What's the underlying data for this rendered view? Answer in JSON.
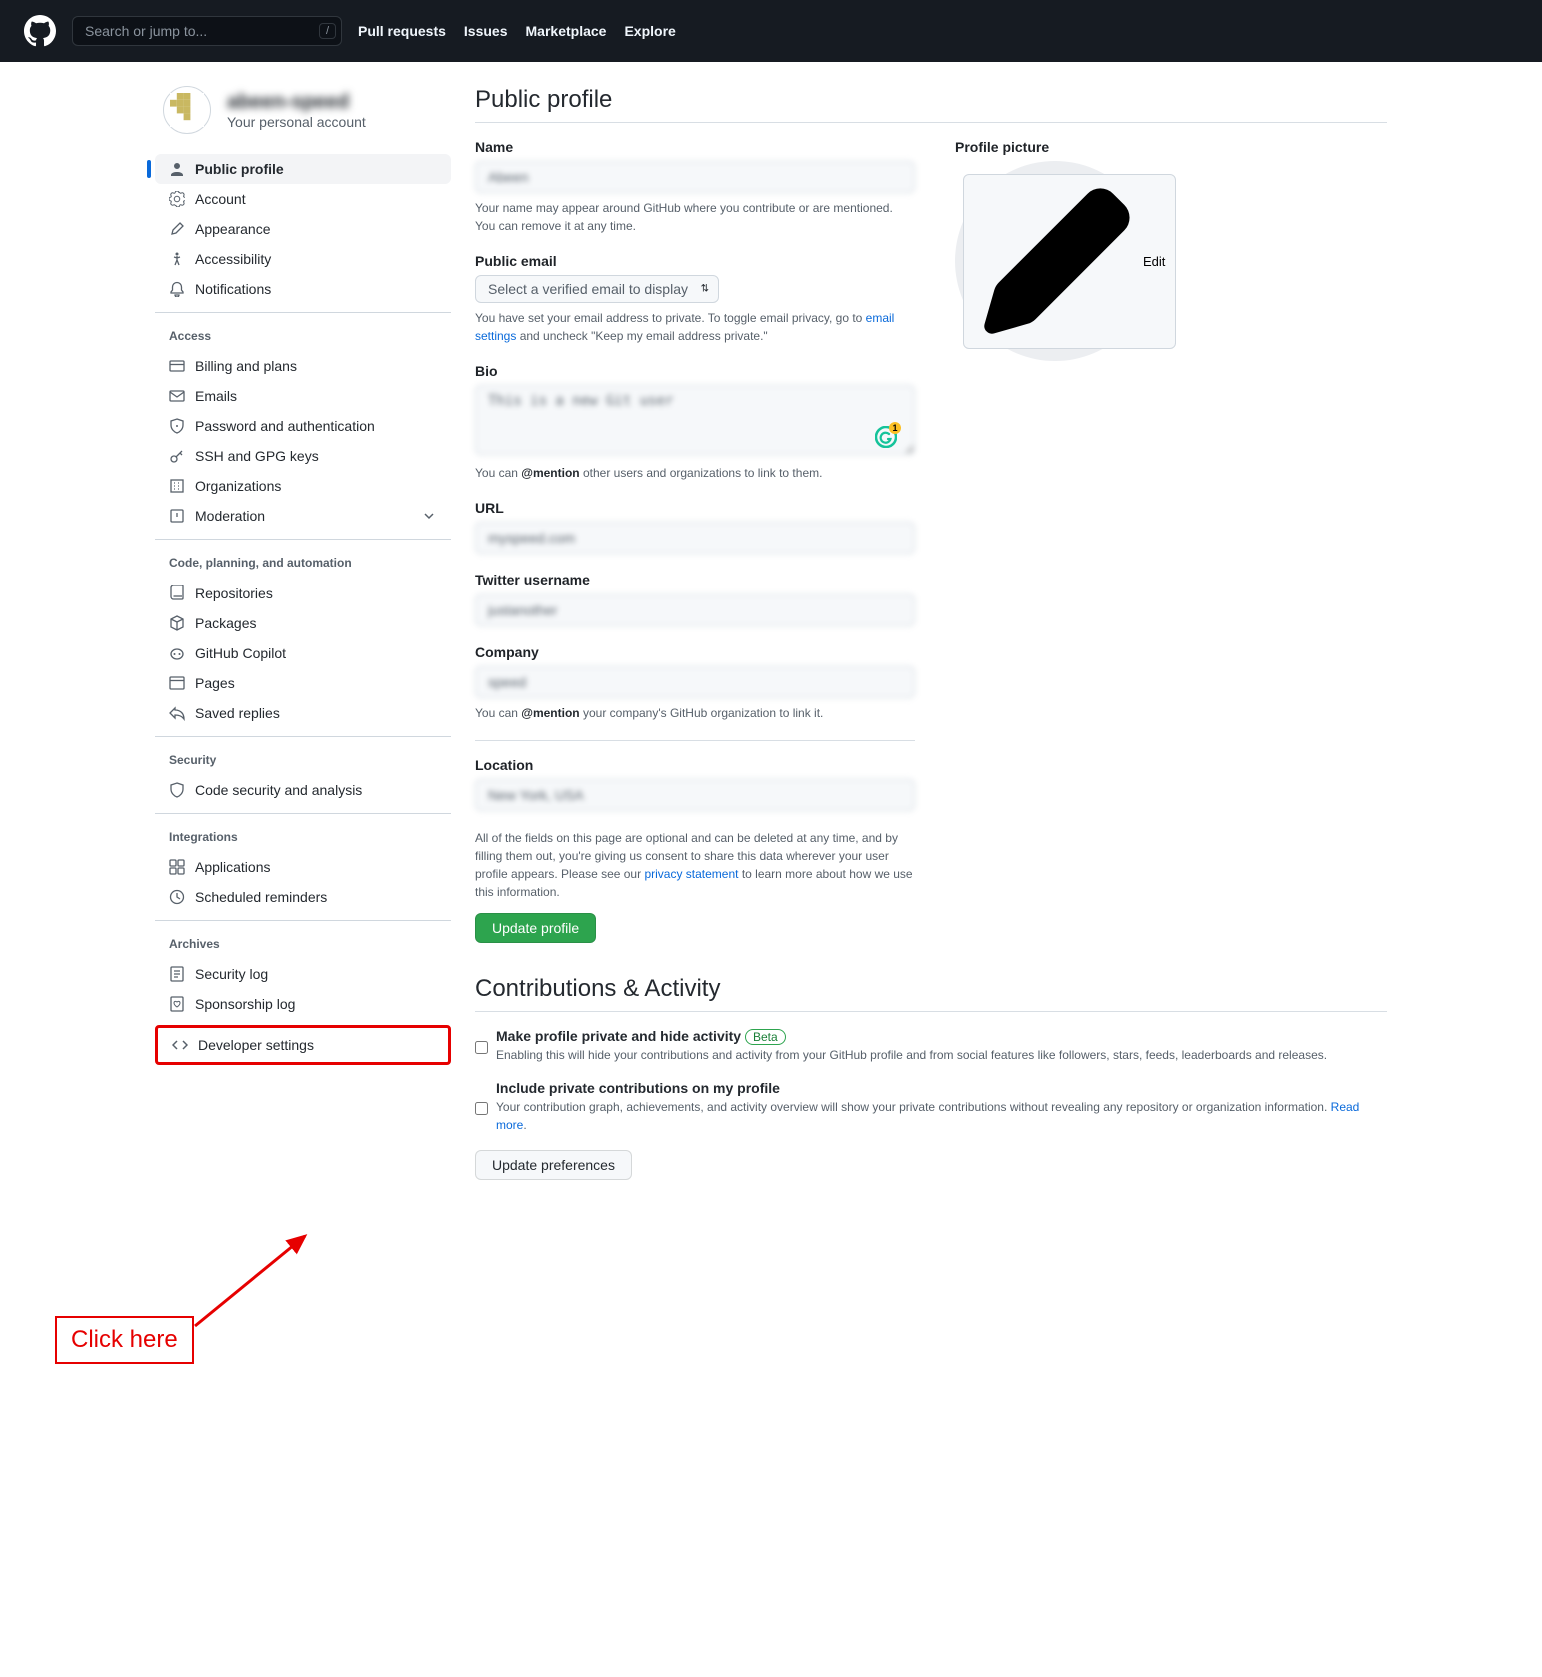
{
  "header": {
    "search_placeholder": "Search or jump to...",
    "nav": [
      "Pull requests",
      "Issues",
      "Marketplace",
      "Explore"
    ]
  },
  "profile": {
    "name": "abeen-speed",
    "subtitle": "Your personal account"
  },
  "sidebar": {
    "groups": [
      {
        "title": null,
        "items": [
          {
            "label": "Public profile",
            "icon": "person",
            "active": true
          },
          {
            "label": "Account",
            "icon": "gear"
          },
          {
            "label": "Appearance",
            "icon": "paintbrush"
          },
          {
            "label": "Accessibility",
            "icon": "accessibility"
          },
          {
            "label": "Notifications",
            "icon": "bell"
          }
        ]
      },
      {
        "title": "Access",
        "items": [
          {
            "label": "Billing and plans",
            "icon": "credit-card"
          },
          {
            "label": "Emails",
            "icon": "mail"
          },
          {
            "label": "Password and authentication",
            "icon": "shield-lock"
          },
          {
            "label": "SSH and GPG keys",
            "icon": "key"
          },
          {
            "label": "Organizations",
            "icon": "organization"
          },
          {
            "label": "Moderation",
            "icon": "report",
            "chevron": true
          }
        ]
      },
      {
        "title": "Code, planning, and automation",
        "items": [
          {
            "label": "Repositories",
            "icon": "repo"
          },
          {
            "label": "Packages",
            "icon": "package"
          },
          {
            "label": "GitHub Copilot",
            "icon": "copilot"
          },
          {
            "label": "Pages",
            "icon": "browser"
          },
          {
            "label": "Saved replies",
            "icon": "reply"
          }
        ]
      },
      {
        "title": "Security",
        "items": [
          {
            "label": "Code security and analysis",
            "icon": "shield"
          }
        ]
      },
      {
        "title": "Integrations",
        "items": [
          {
            "label": "Applications",
            "icon": "apps"
          },
          {
            "label": "Scheduled reminders",
            "icon": "clock"
          }
        ]
      },
      {
        "title": "Archives",
        "items": [
          {
            "label": "Security log",
            "icon": "log"
          },
          {
            "label": "Sponsorship log",
            "icon": "heart-log"
          }
        ]
      }
    ],
    "developer_settings": "Developer settings"
  },
  "annotation": {
    "text": "Click here"
  },
  "main": {
    "title": "Public profile",
    "name": {
      "label": "Name",
      "value": "Abeen",
      "help": "Your name may appear around GitHub where you contribute or are mentioned. You can remove it at any time."
    },
    "email": {
      "label": "Public email",
      "placeholder": "Select a verified email to display",
      "help_pre": "You have set your email address to private. To toggle email privacy, go to ",
      "help_link": "email settings",
      "help_post": " and uncheck \"Keep my email address private.\""
    },
    "bio": {
      "label": "Bio",
      "value": "This is a new Git user",
      "help_pre": "You can ",
      "help_bold": "@mention",
      "help_post": " other users and organizations to link to them."
    },
    "url": {
      "label": "URL",
      "value": "myspeed.com"
    },
    "twitter": {
      "label": "Twitter username",
      "value": "justanother"
    },
    "company": {
      "label": "Company",
      "value": "speed",
      "help_pre": "You can ",
      "help_bold": "@mention",
      "help_post": " your company's GitHub organization to link it."
    },
    "location": {
      "label": "Location",
      "value": "New York, USA"
    },
    "disclaimer_pre": "All of the fields on this page are optional and can be deleted at any time, and by filling them out, you're giving us consent to share this data wherever your user profile appears. Please see our ",
    "disclaimer_link": "privacy statement",
    "disclaimer_post": " to learn more about how we use this information.",
    "update_button": "Update profile",
    "picture": {
      "label": "Profile picture",
      "edit": "Edit"
    },
    "contrib": {
      "title": "Contributions & Activity",
      "private": {
        "label": "Make profile private and hide activity",
        "badge": "Beta",
        "desc": "Enabling this will hide your contributions and activity from your GitHub profile and from social features like followers, stars, feeds, leaderboards and releases."
      },
      "include": {
        "label": "Include private contributions on my profile",
        "desc_pre": "Your contribution graph, achievements, and activity overview will show your private contributions without revealing any repository or organization information. ",
        "desc_link": "Read more",
        "desc_post": "."
      },
      "update_prefs": "Update preferences"
    }
  }
}
